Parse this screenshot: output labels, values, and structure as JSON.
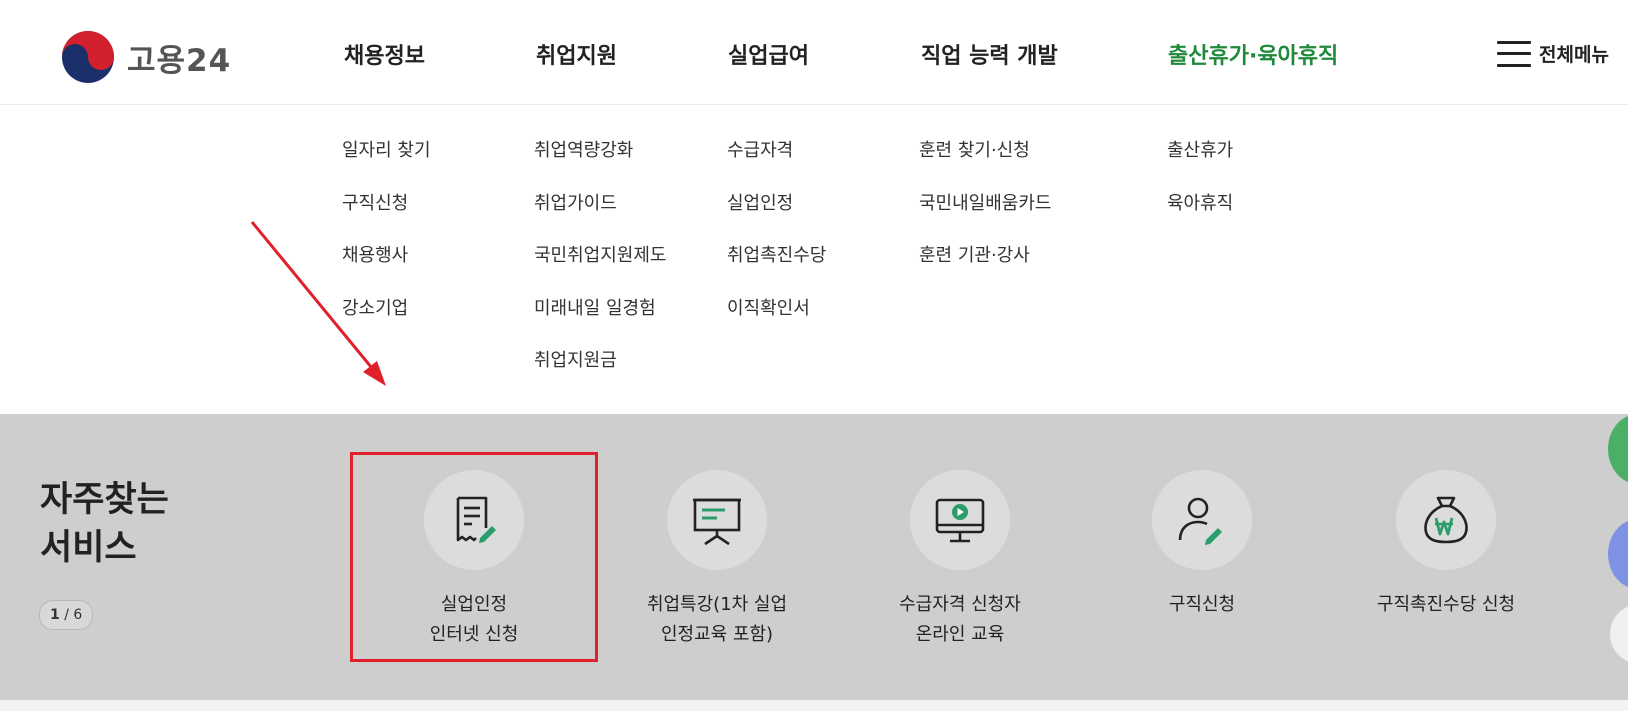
{
  "header": {
    "logo_text": "고용24",
    "nav": [
      {
        "label": "채용정보"
      },
      {
        "label": "취업지원"
      },
      {
        "label": "실업급여"
      },
      {
        "label": "직업 능력 개발"
      },
      {
        "label": "출산휴가·육아휴직"
      }
    ],
    "all_menu_label": "전체메뉴"
  },
  "submenu": [
    [
      "일자리 찾기",
      "구직신청",
      "채용행사",
      "강소기업"
    ],
    [
      "취업역량강화",
      "취업가이드",
      "국민취업지원제도",
      "미래내일 일경험",
      "취업지원금"
    ],
    [
      "수급자격",
      "실업인정",
      "취업촉진수당",
      "이직확인서"
    ],
    [
      "훈련 찾기·신청",
      "국민내일배움카드",
      "훈련 기관·강사"
    ],
    [
      "출산휴가",
      "육아휴직"
    ]
  ],
  "services": {
    "title_line1": "자주찾는",
    "title_line2": "서비스",
    "pager_current": "1",
    "pager_sep": " / ",
    "pager_total": "6",
    "items": [
      {
        "label": "실업인정\n인터넷 신청",
        "icon": "document-edit-icon"
      },
      {
        "label": "취업특강(1차 실업\n인정교육 포함)",
        "icon": "presentation-board-icon"
      },
      {
        "label": "수급자격 신청자\n온라인 교육",
        "icon": "monitor-play-icon"
      },
      {
        "label": "구직신청",
        "icon": "person-edit-icon"
      },
      {
        "label": "구직촉진수당 신청",
        "icon": "money-bag-won-icon"
      }
    ]
  },
  "colors": {
    "accent_green": "#1f8a3a",
    "icon_green": "#2a9d6a",
    "highlight_red": "#e0202a",
    "band_gray": "#cecece"
  }
}
